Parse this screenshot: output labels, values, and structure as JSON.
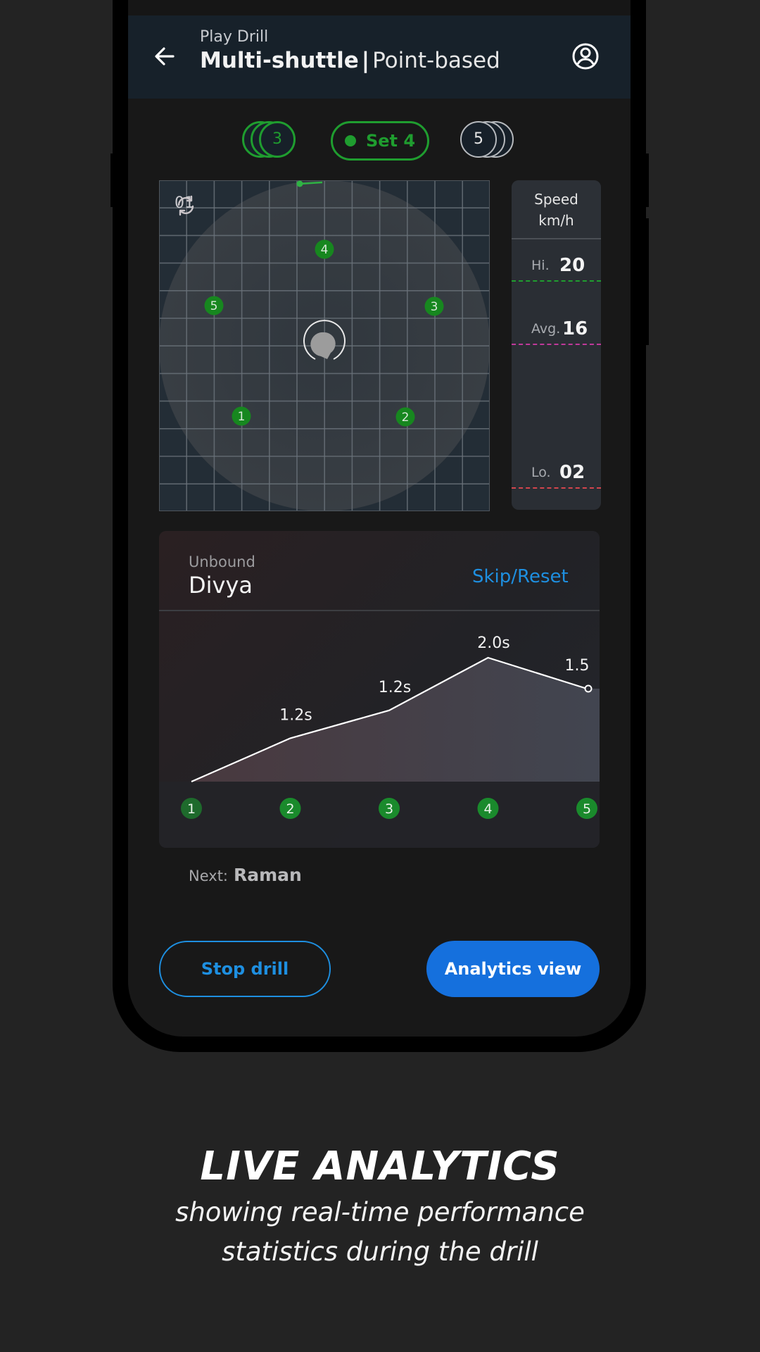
{
  "app_bar": {
    "subtitle": "Play Drill",
    "title_bold": "Multi-shuttle",
    "separator": "|",
    "title_light": "Point-based",
    "back_icon": "arrow-left-icon",
    "profile_icon": "user-circle-icon"
  },
  "sets": {
    "previous": "3",
    "current": "Set 4",
    "next": "5"
  },
  "court": {
    "cycle_icon": "repeat-icon",
    "cycle_count": "01",
    "markers": [
      {
        "label": "4"
      },
      {
        "label": "5"
      },
      {
        "label": "3"
      },
      {
        "label": "1"
      },
      {
        "label": "2"
      }
    ]
  },
  "speed": {
    "title": "Speed",
    "unit": "km/h",
    "hi_label": "Hi.",
    "hi_value": "20",
    "avg_label": "Avg.",
    "avg_value": "16",
    "lo_label": "Lo.",
    "lo_value": "02",
    "colors": {
      "hi": "#1f9d2f",
      "avg": "#c0399a",
      "lo": "#d2454d"
    }
  },
  "player_card": {
    "status": "Unbound",
    "name": "Divya",
    "skip_reset": "Skip/Reset"
  },
  "chart_data": {
    "type": "area",
    "x": [
      "1",
      "2",
      "3",
      "4",
      "5"
    ],
    "values": [
      0.0,
      1.2,
      1.2,
      2.0,
      1.5
    ],
    "plotted": [
      0.0,
      0.7,
      1.15,
      2.0,
      1.5
    ],
    "data_labels": [
      "",
      "1.2s",
      "1.2s",
      "2.0s",
      "1.5"
    ],
    "ylabel": "",
    "ylim": [
      0,
      2.2
    ],
    "grid": false,
    "line_color": "#ffffff",
    "marker_color": "#1a8a2c"
  },
  "next": {
    "label": "Next:",
    "name": "Raman"
  },
  "actions": {
    "stop": "Stop drill",
    "analytics": "Analytics view"
  },
  "caption": {
    "headline": "LIVE ANALYTICS",
    "line1": "showing real-time performance",
    "line2": "statistics during the drill"
  },
  "colors": {
    "accent_green": "#1f9d2f",
    "accent_blue": "#1570dd",
    "link_blue": "#1e8fe0",
    "app_bar_bg": "#17212a"
  }
}
